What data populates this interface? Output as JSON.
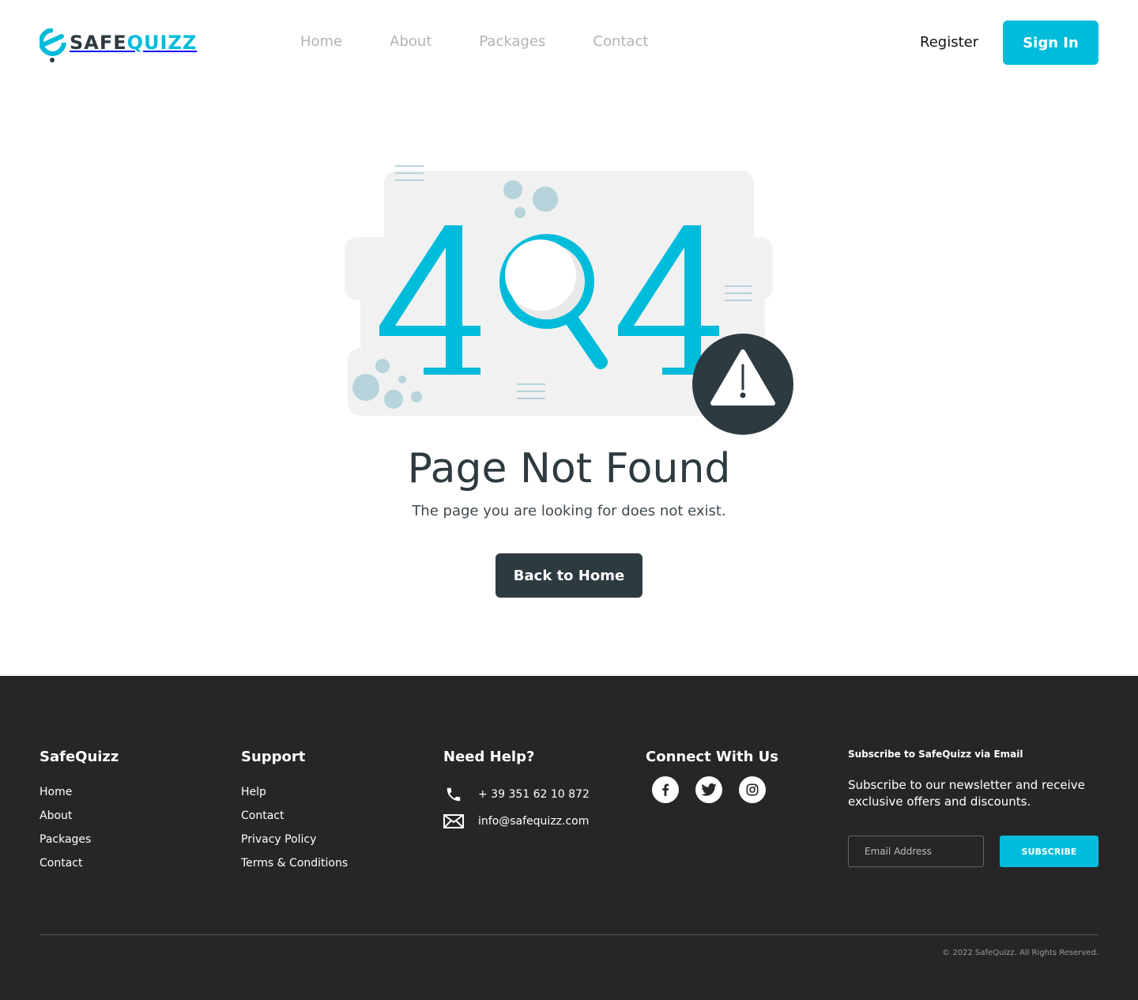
{
  "header": {
    "logo": {
      "part1": "SAFE",
      "part2": "QUIZZ"
    },
    "nav": [
      {
        "label": "Home"
      },
      {
        "label": "About"
      },
      {
        "label": "Packages"
      },
      {
        "label": "Contact"
      }
    ],
    "register_label": "Register",
    "signin_label": "Sign In"
  },
  "main": {
    "illustration_text": "404",
    "title": "Page Not Found",
    "subtitle": "The page you are looking for does not exist.",
    "back_label": "Back to Home"
  },
  "footer": {
    "col1": {
      "title": "SafeQuizz",
      "links": [
        "Home",
        "About",
        "Packages",
        "Contact"
      ]
    },
    "col2": {
      "title": "Support",
      "links": [
        "Help",
        "Contact",
        "Privacy Policy",
        "Terms & Conditions"
      ]
    },
    "col3": {
      "title": "Need Help?",
      "phone": "+ 39 351 62 10 872",
      "email": "info@safequizz.com"
    },
    "col4": {
      "title": "Connect With Us",
      "socials": [
        "facebook-icon",
        "twitter-icon",
        "instagram-icon"
      ]
    },
    "col5": {
      "title": "Subscribe to SafeQuizz via Email",
      "text": "Subscribe to our newsletter and receive exclusive offers and discounts.",
      "email_placeholder": "Email Address",
      "button_label": "SUBSCRIBE"
    },
    "copyright": "© 2022 SafeQuizz. All Rights Reserved."
  },
  "colors": {
    "accent": "#00bcdb",
    "dark": "#2d3a40",
    "footer_bg": "#262626"
  }
}
